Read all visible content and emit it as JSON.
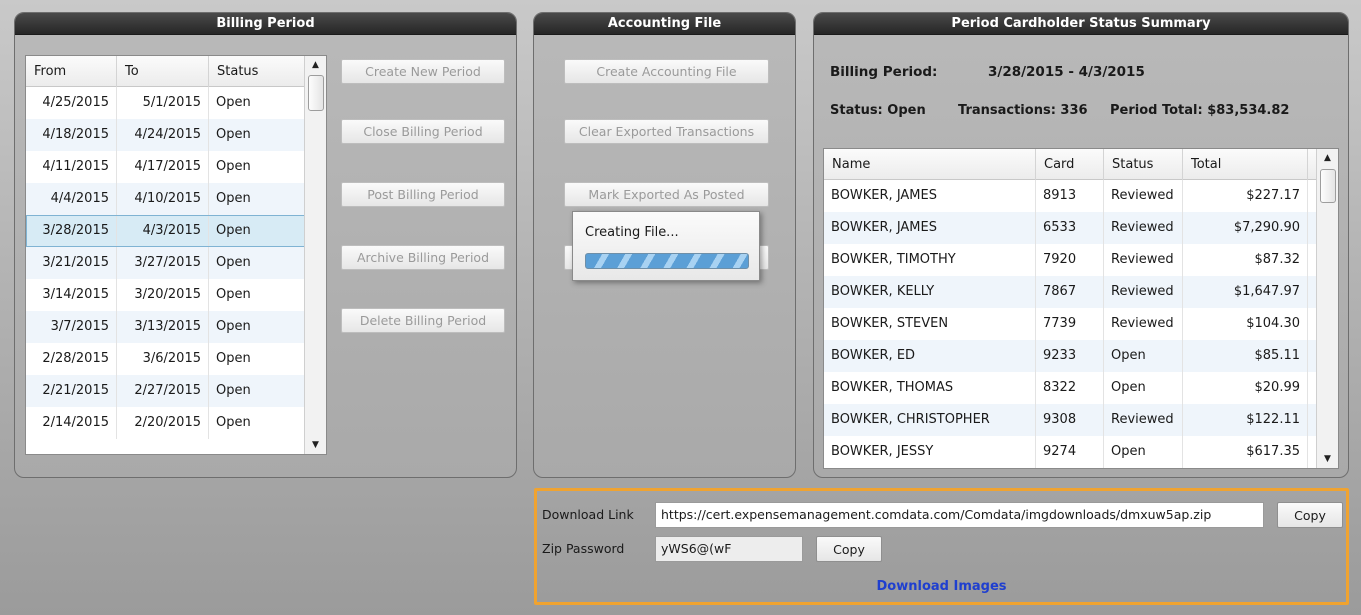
{
  "billing_panel": {
    "title": "Billing Period",
    "columns": [
      "From",
      "To",
      "Status"
    ],
    "rows": [
      {
        "from": "4/25/2015",
        "to": "5/1/2015",
        "status": "Open"
      },
      {
        "from": "4/18/2015",
        "to": "4/24/2015",
        "status": "Open"
      },
      {
        "from": "4/11/2015",
        "to": "4/17/2015",
        "status": "Open"
      },
      {
        "from": "4/4/2015",
        "to": "4/10/2015",
        "status": "Open"
      },
      {
        "from": "3/28/2015",
        "to": "4/3/2015",
        "status": "Open"
      },
      {
        "from": "3/21/2015",
        "to": "3/27/2015",
        "status": "Open"
      },
      {
        "from": "3/14/2015",
        "to": "3/20/2015",
        "status": "Open"
      },
      {
        "from": "3/7/2015",
        "to": "3/13/2015",
        "status": "Open"
      },
      {
        "from": "2/28/2015",
        "to": "3/6/2015",
        "status": "Open"
      },
      {
        "from": "2/21/2015",
        "to": "2/27/2015",
        "status": "Open"
      },
      {
        "from": "2/14/2015",
        "to": "2/20/2015",
        "status": "Open"
      }
    ],
    "selected_from": "3/28/2015",
    "buttons": {
      "create": "Create New Period",
      "close": "Close Billing Period",
      "post": "Post Billing Period",
      "archive": "Archive Billing Period",
      "delete": "Delete Billing Period"
    }
  },
  "accounting_panel": {
    "title": "Accounting File",
    "buttons": {
      "create_file": "Create Accounting File",
      "clear_exported": "Clear Exported Transactions",
      "mark_posted": "Mark Exported As Posted"
    },
    "progress_popup": {
      "text": "Creating File...",
      "state": "indeterminate"
    }
  },
  "summary_panel": {
    "title": "Period Cardholder Status Summary",
    "billing_period_label": "Billing Period:",
    "billing_period_value": "3/28/2015 - 4/3/2015",
    "status_text": "Status: Open",
    "transactions_text": "Transactions: 336",
    "period_total_text": "Period Total: $83,534.82",
    "columns": [
      "Name",
      "Card",
      "Status",
      "Total"
    ],
    "rows": [
      {
        "name": "BOWKER, JAMES",
        "card": "8913",
        "status": "Reviewed",
        "total": "$227.17"
      },
      {
        "name": "BOWKER, JAMES",
        "card": "6533",
        "status": "Reviewed",
        "total": "$7,290.90"
      },
      {
        "name": "BOWKER, TIMOTHY",
        "card": "7920",
        "status": "Reviewed",
        "total": "$87.32"
      },
      {
        "name": "BOWKER, KELLY",
        "card": "7867",
        "status": "Reviewed",
        "total": "$1,647.97"
      },
      {
        "name": "BOWKER, STEVEN",
        "card": "7739",
        "status": "Reviewed",
        "total": "$104.30"
      },
      {
        "name": "BOWKER, ED",
        "card": "9233",
        "status": "Open",
        "total": "$85.11"
      },
      {
        "name": "BOWKER, THOMAS",
        "card": "8322",
        "status": "Open",
        "total": "$20.99"
      },
      {
        "name": "BOWKER, CHRISTOPHER",
        "card": "9308",
        "status": "Reviewed",
        "total": "$122.11"
      },
      {
        "name": "BOWKER, JESSY",
        "card": "9274",
        "status": "Open",
        "total": "$617.35"
      }
    ]
  },
  "download": {
    "link_label": "Download Link",
    "link_value": "https://cert.expensemanagement.comdata.com/Comdata/imgdownloads/dmxuw5ap.zip",
    "copy_label": "Copy",
    "zip_label": "Zip Password",
    "zip_value": "yWS6@(wF",
    "download_images": "Download Images",
    "highlight_color": "#f0a330",
    "link_color": "#1f3fcf"
  }
}
